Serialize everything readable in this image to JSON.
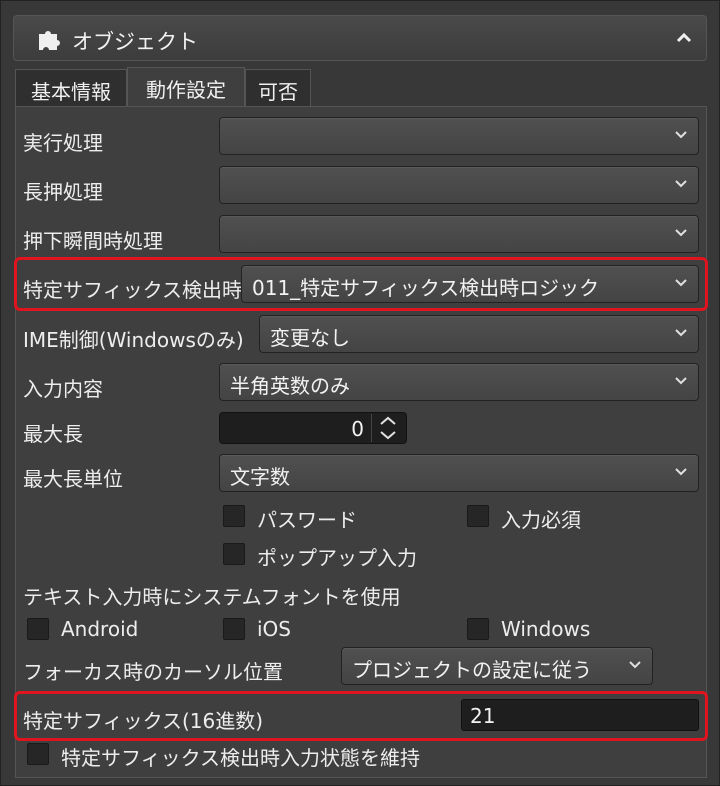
{
  "header": {
    "title": "オブジェクト",
    "icon": "puzzle-icon",
    "collapse_icon": "chevron-up-icon"
  },
  "tabs": [
    {
      "label": "基本情報"
    },
    {
      "label": "動作設定"
    },
    {
      "label": "可否"
    }
  ],
  "fields": {
    "exec": {
      "label": "実行処理",
      "value": ""
    },
    "longpress": {
      "label": "長押処理",
      "value": ""
    },
    "pressdown": {
      "label": "押下瞬間時処理",
      "value": ""
    },
    "suffix_detect": {
      "label": "特定サフィックス検出時",
      "value": "011_特定サフィックス検出時ロジック"
    },
    "ime": {
      "label": "IME制御(Windowsのみ)",
      "value": "変更なし"
    },
    "input_content": {
      "label": "入力内容",
      "value": "半角英数のみ"
    },
    "maxlen": {
      "label": "最大長",
      "value": "0"
    },
    "maxlen_unit": {
      "label": "最大長単位",
      "value": "文字数"
    }
  },
  "checks": {
    "password": "パスワード",
    "required": "入力必須",
    "popup": "ポップアップ入力",
    "android": "Android",
    "ios": "iOS",
    "windows": "Windows",
    "keep_state": "特定サフィックス検出時入力状態を維持"
  },
  "system_font_label": "テキスト入力時にシステムフォントを使用",
  "cursor": {
    "label": "フォーカス時のカーソル位置",
    "value": "プロジェクトの設定に従う"
  },
  "suffix_hex": {
    "label": "特定サフィックス(16進数)",
    "value": "21"
  },
  "colors": {
    "highlight": "#e0141e",
    "panel": "#3f3f3f"
  }
}
